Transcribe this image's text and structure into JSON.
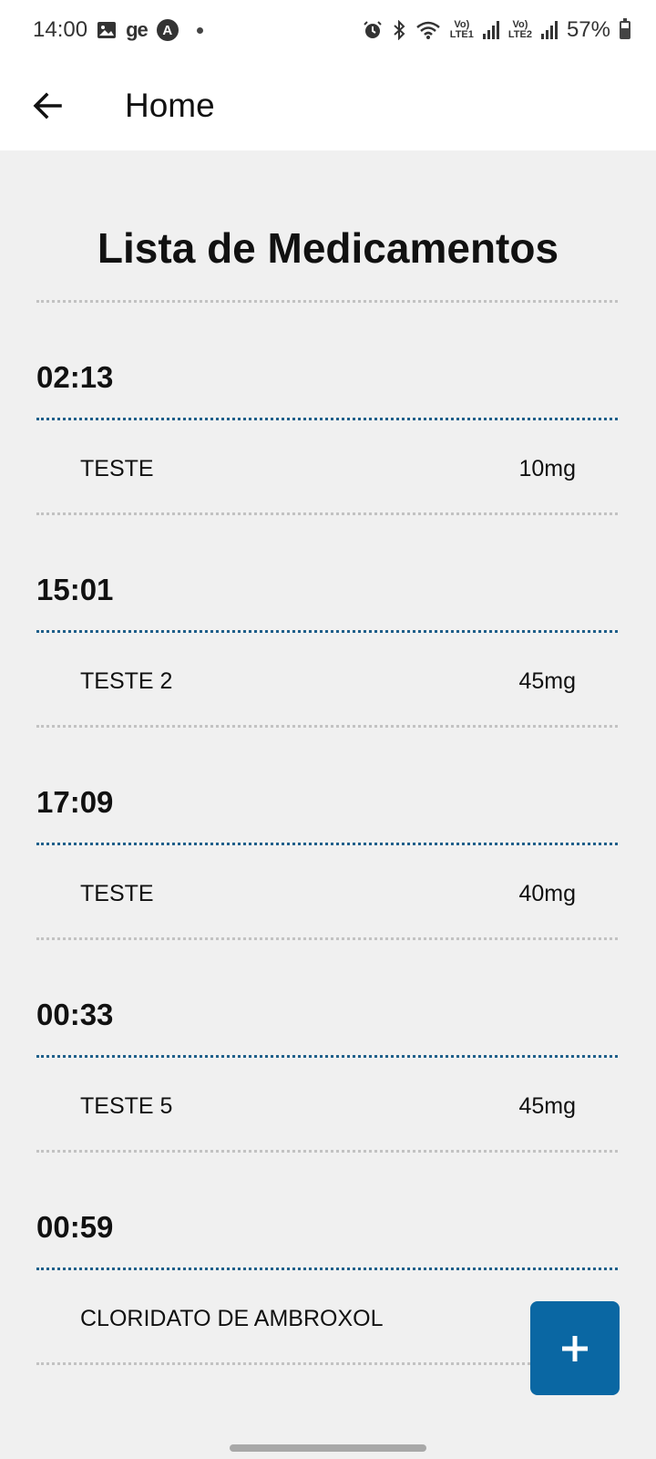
{
  "status_bar": {
    "time": "14:00",
    "notif_app": "ge",
    "notif_letter": "A",
    "sim1_top": "Vo)",
    "sim1_bottom": "LTE1",
    "sim2_top": "Vo)",
    "sim2_bottom": "LTE2",
    "battery": "57%"
  },
  "app_bar": {
    "title": "Home"
  },
  "page": {
    "title": "Lista de Medicamentos"
  },
  "medications": [
    {
      "time": "02:13",
      "name": "TESTE",
      "dose": "10mg"
    },
    {
      "time": "15:01",
      "name": "TESTE 2",
      "dose": "45mg"
    },
    {
      "time": "17:09",
      "name": "TESTE",
      "dose": "40mg"
    },
    {
      "time": "00:33",
      "name": "TESTE 5",
      "dose": "45mg"
    },
    {
      "time": "00:59",
      "name": "CLORIDATO DE AMBROXOL",
      "dose": ""
    }
  ],
  "colors": {
    "accent": "#0a67a3",
    "divider_blue": "#1f5f8a",
    "divider_gray": "#c2c2c2",
    "background": "#f0f0f0"
  },
  "icons": {
    "back": "arrow-left-icon",
    "fab": "plus-icon"
  }
}
